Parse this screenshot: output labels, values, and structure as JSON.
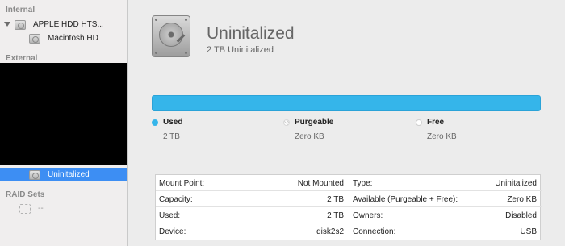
{
  "sidebar": {
    "internal_header": "Internal",
    "disk_label": "APPLE HDD HTS...",
    "volume_label": "Macintosh HD",
    "external_header": "External",
    "selected_label": "Uninitalized",
    "raid_header": "RAID Sets",
    "raid_item_label": "--"
  },
  "main": {
    "title": "Uninitalized",
    "subtitle": "2 TB Uninitalized",
    "usage": [
      {
        "label": "Used",
        "value": "2 TB",
        "color": "#35b5ea",
        "fraction": 1.0
      },
      {
        "label": "Purgeable",
        "value": "Zero KB",
        "color": "#ffffff",
        "fraction": 0.0
      },
      {
        "label": "Free",
        "value": "Zero KB",
        "color": "#ffffff",
        "fraction": 0.0
      }
    ],
    "info_left": [
      {
        "key": "Mount Point:",
        "value": "Not Mounted"
      },
      {
        "key": "Capacity:",
        "value": "2 TB"
      },
      {
        "key": "Used:",
        "value": "2 TB"
      },
      {
        "key": "Device:",
        "value": "disk2s2"
      }
    ],
    "info_right": [
      {
        "key": "Type:",
        "value": "Uninitalized"
      },
      {
        "key": "Available (Purgeable + Free):",
        "value": "Zero KB"
      },
      {
        "key": "Owners:",
        "value": "Disabled"
      },
      {
        "key": "Connection:",
        "value": "USB"
      }
    ]
  }
}
